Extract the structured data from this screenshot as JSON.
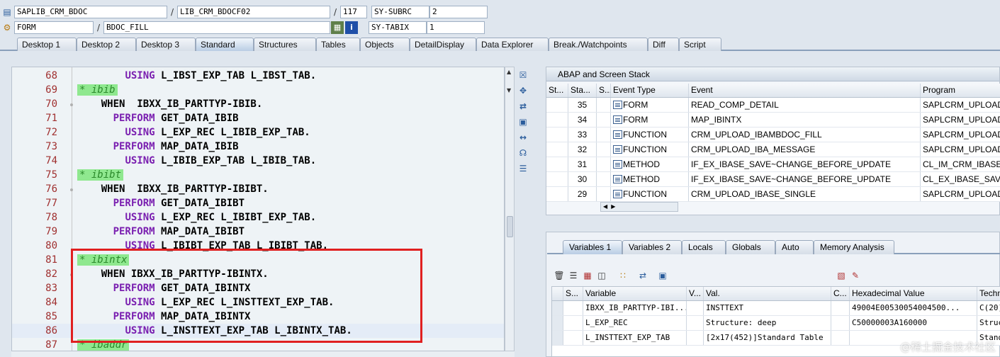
{
  "info": {
    "program": "SAPLIB_CRM_BDOC",
    "include": "LIB_CRM_BDOCF02",
    "line": "117",
    "field1_name": "SY-SUBRC",
    "field1_value": "2",
    "event_type": "FORM",
    "event": "BDOC_FILL",
    "field2_name": "SY-TABIX",
    "field2_value": "1"
  },
  "tabs": [
    "Desktop 1",
    "Desktop 2",
    "Desktop 3",
    "Standard",
    "Structures",
    "Tables",
    "Objects",
    "DetailDisplay",
    "Data Explorer",
    "Break./Watchpoints",
    "Diff",
    "Script"
  ],
  "active_tab": "Standard",
  "code_lines": [
    {
      "n": "68",
      "parts": [
        {
          "t": "        "
        },
        {
          "t": "USING",
          "k": "kw"
        },
        {
          "t": " L_IBST_EXP_TAB L_IBST_TAB."
        }
      ]
    },
    {
      "n": "69",
      "parts": [
        {
          "t": "* ibib",
          "k": "cmt"
        }
      ]
    },
    {
      "n": "70",
      "parts": [
        {
          "t": "    WHEN  IBXX_IB_PARTTYP-IBIB."
        }
      ]
    },
    {
      "n": "71",
      "parts": [
        {
          "t": "      "
        },
        {
          "t": "PERFORM",
          "k": "kw"
        },
        {
          "t": " GET_DATA_IBIB"
        }
      ]
    },
    {
      "n": "72",
      "parts": [
        {
          "t": "        "
        },
        {
          "t": "USING",
          "k": "kw"
        },
        {
          "t": " L_EXP_REC L_IBIB_EXP_TAB."
        }
      ]
    },
    {
      "n": "73",
      "parts": [
        {
          "t": "      "
        },
        {
          "t": "PERFORM",
          "k": "kw"
        },
        {
          "t": " MAP_DATA_IBIB"
        }
      ]
    },
    {
      "n": "74",
      "parts": [
        {
          "t": "        "
        },
        {
          "t": "USING",
          "k": "kw"
        },
        {
          "t": " L_IBIB_EXP_TAB L_IBIB_TAB."
        }
      ]
    },
    {
      "n": "75",
      "parts": [
        {
          "t": "* ibibt",
          "k": "cmt"
        }
      ]
    },
    {
      "n": "76",
      "parts": [
        {
          "t": "    WHEN  IBXX_IB_PARTTYP-IBIBT."
        }
      ]
    },
    {
      "n": "77",
      "parts": [
        {
          "t": "      "
        },
        {
          "t": "PERFORM",
          "k": "kw"
        },
        {
          "t": " GET_DATA_IBIBT"
        }
      ]
    },
    {
      "n": "78",
      "parts": [
        {
          "t": "        "
        },
        {
          "t": "USING",
          "k": "kw"
        },
        {
          "t": " L_EXP_REC L_IBIBT_EXP_TAB."
        }
      ]
    },
    {
      "n": "79",
      "parts": [
        {
          "t": "      "
        },
        {
          "t": "PERFORM",
          "k": "kw"
        },
        {
          "t": " MAP_DATA_IBIBT"
        }
      ]
    },
    {
      "n": "80",
      "parts": [
        {
          "t": "        "
        },
        {
          "t": "USING",
          "k": "kw"
        },
        {
          "t": " L_IBIBT_EXP_TAB L_IBIBT_TAB."
        }
      ]
    },
    {
      "n": "81",
      "parts": [
        {
          "t": "* ibintx",
          "k": "cmt"
        }
      ]
    },
    {
      "n": "82",
      "parts": [
        {
          "t": "    WHEN IBXX_IB_PARTTYP-IBINTX."
        }
      ]
    },
    {
      "n": "83",
      "parts": [
        {
          "t": "      "
        },
        {
          "t": "PERFORM",
          "k": "kw"
        },
        {
          "t": " GET_DATA_IBINTX"
        }
      ]
    },
    {
      "n": "84",
      "parts": [
        {
          "t": "        "
        },
        {
          "t": "USING",
          "k": "kw"
        },
        {
          "t": " L_EXP_REC L_INSTTEXT_EXP_TAB."
        }
      ]
    },
    {
      "n": "85",
      "parts": [
        {
          "t": "      "
        },
        {
          "t": "PERFORM",
          "k": "kw"
        },
        {
          "t": " MAP_DATA_IBINTX"
        }
      ]
    },
    {
      "n": "86",
      "parts": [
        {
          "t": "        "
        },
        {
          "t": "USING",
          "k": "kw"
        },
        {
          "t": " L_INSTTEXT_EXP_TAB L_IBINTX_TAB."
        }
      ],
      "current": true
    },
    {
      "n": "87",
      "parts": [
        {
          "t": "* ibaddr",
          "k": "cmt"
        }
      ]
    }
  ],
  "stack": {
    "title": "ABAP and Screen Stack",
    "columns": [
      "St...",
      "Sta...",
      "S...",
      "Event Type",
      "Event",
      "Program"
    ],
    "rows": [
      {
        "sta": "35",
        "type": "FORM",
        "event": "READ_COMP_DETAIL",
        "program": "SAPLCRM_UPLOAD_..."
      },
      {
        "sta": "34",
        "type": "FORM",
        "event": "MAP_IBINTX",
        "program": "SAPLCRM_UPLOAD_..."
      },
      {
        "sta": "33",
        "type": "FUNCTION",
        "event": "CRM_UPLOAD_IBAMBDOC_FILL",
        "program": "SAPLCRM_UPLOAD_..."
      },
      {
        "sta": "32",
        "type": "FUNCTION",
        "event": "CRM_UPLOAD_IBA_MESSAGE",
        "program": "SAPLCRM_UPLOAD_..."
      },
      {
        "sta": "31",
        "type": "METHOD",
        "event": "IF_EX_IBASE_SAVE~CHANGE_BEFORE_UPDATE",
        "program": "CL_IM_CRM_IBASE_..."
      },
      {
        "sta": "30",
        "type": "METHOD",
        "event": "IF_EX_IBASE_SAVE~CHANGE_BEFORE_UPDATE",
        "program": "CL_EX_IBASE_SAVE..."
      },
      {
        "sta": "29",
        "type": "FUNCTION",
        "event": "CRM_UPLOAD_IBASE_SINGLE",
        "program": "SAPLCRM_UPLOAD_..."
      }
    ]
  },
  "var_tabs": [
    "Variables 1",
    "Variables 2",
    "Locals",
    "Globals",
    "Auto",
    "Memory Analysis"
  ],
  "active_var_tab": "Variables 1",
  "variables": {
    "columns": [
      "S...",
      "Variable",
      "V...",
      "Val.",
      "C...",
      "Hexadecimal Value",
      "Techn"
    ],
    "rows": [
      {
        "variable": "IBXX_IB_PARTTYP-IBI...",
        "val": "INSTTEXT",
        "hex": "49004E00530054004500...",
        "tech": "C(20)"
      },
      {
        "variable": "L_EXP_REC",
        "val": "Structure: deep",
        "hex": "C50000003A160000",
        "tech": "Struct"
      },
      {
        "variable": "L_INSTTEXT_EXP_TAB",
        "val": "[2x17(452)]Standard Table",
        "hex": "",
        "tech": "Stand"
      }
    ]
  },
  "watermark": "@稀土掘金技术社区",
  "colors": {
    "keyword": "#7a1fb0",
    "comment_bg": "#8fe88f",
    "line_number": "#a03030",
    "highlight_box": "#e02020"
  }
}
